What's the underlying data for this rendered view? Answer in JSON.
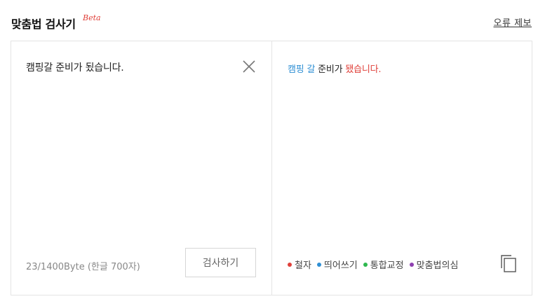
{
  "header": {
    "title": "맞춤법 검사기",
    "beta": "Beta",
    "report_link": "오류 제보"
  },
  "input": {
    "text": "캠핑갈 준비가 됬습니다.",
    "byte_count": "23/1400Byte (한글 700자)",
    "check_button": "검사하기"
  },
  "result": {
    "parts": [
      {
        "text": "캠핑 갈",
        "type": "spacing"
      },
      {
        "text": " 준비가 ",
        "type": "normal"
      },
      {
        "text": "됐습니다.",
        "type": "spelling"
      }
    ]
  },
  "legend": [
    {
      "label": "철자",
      "color": "#e0403a"
    },
    {
      "label": "띄어쓰기",
      "color": "#2f8fd4"
    },
    {
      "label": "통합교정",
      "color": "#2eb84e"
    },
    {
      "label": "맞춤법의심",
      "color": "#8e3fb0"
    }
  ],
  "icons": {
    "clear": "close-icon",
    "copy": "copy-icon"
  }
}
